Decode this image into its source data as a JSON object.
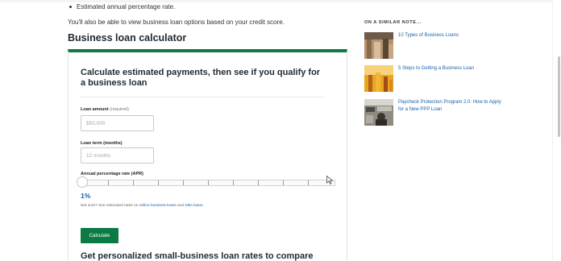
{
  "article": {
    "bullet": "Estimated annual percentage rate.",
    "intro": "You'll also be able to view business loan options based on your credit score.",
    "section_title": "Business loan calculator"
  },
  "calculator": {
    "heading": "Calculate estimated payments, then see if you qualify for a business loan",
    "loan_amount_label": "Loan amount",
    "loan_amount_note": "(required)",
    "loan_amount_placeholder": "$50,000",
    "loan_term_label": "Loan term (months)",
    "loan_term_placeholder": "12 months",
    "apr_label": "Annual percentage rate (APR)",
    "apr_value": "1%",
    "apr_fraction": 0,
    "note_prefix": "Not sure? See estimated rates on",
    "note_link_1": "online business loans",
    "note_middle": "and",
    "note_link_2": "SBA loans",
    "note_suffix": ".",
    "calculate_label": "Calculate",
    "subheading": "Get personalized small-business loan rates to compare"
  },
  "sidebar": {
    "title": "ON A SIMILAR NOTE...",
    "items": [
      {
        "title": "10 Types of Business Loans"
      },
      {
        "title": "5 Steps to Getting a Business Loan"
      },
      {
        "title": "Paycheck Protection Program 2.0: How to Apply for a New PPP Loan"
      }
    ]
  },
  "colors": {
    "accent": "#0c7a43",
    "link": "#1a63a8",
    "heading": "#1f2a32"
  }
}
